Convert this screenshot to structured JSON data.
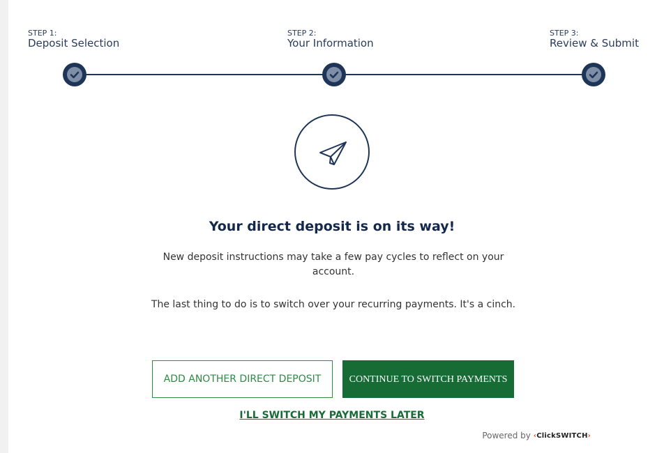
{
  "steps": [
    {
      "num": "STEP 1:",
      "name": "Deposit Selection",
      "status": "complete"
    },
    {
      "num": "STEP 2:",
      "name": "Your Information",
      "status": "complete"
    },
    {
      "num": "STEP 3:",
      "name": "Review & Submit",
      "status": "complete"
    }
  ],
  "icons": {
    "step_check": "check-icon",
    "hero": "paper-plane-icon"
  },
  "colors": {
    "navy": "#1e3557",
    "green": "#176b34",
    "green_outline": "#2e8b44",
    "brand_chevron": "#d9532c"
  },
  "main": {
    "headline": "Your direct deposit is on its way!",
    "paragraph1": "New deposit instructions may take a few pay cycles to reflect on your account.",
    "paragraph2": "The last thing to do is to switch over your recurring payments. It's a cinch."
  },
  "actions": {
    "add_another": "ADD ANOTHER DIRECT DEPOSIT",
    "continue": "CONTINUE TO SWITCH PAYMENTS",
    "later": "I'LL SWITCH MY PAYMENTS LATER"
  },
  "footer": {
    "powered_by": "Powered by",
    "brand_left": "‹",
    "brand": "ClickSWITCH",
    "brand_right": "›"
  }
}
